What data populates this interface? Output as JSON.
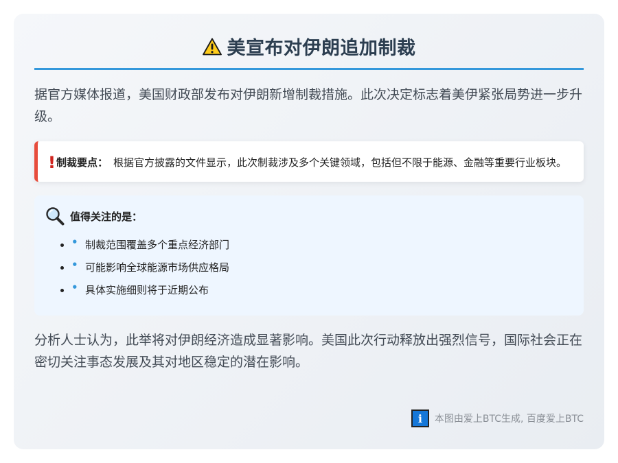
{
  "header": {
    "title": "美宣布对伊朗追加制裁",
    "icon": "warning-icon"
  },
  "lead_paragraph": "据官方媒体报道，美国财政部发布对伊朗新增制裁措施。此次决定标志着美伊紧张局势进一步升级。",
  "alert": {
    "icon": "exclamation-icon",
    "label": "制裁要点：",
    "text": "根据官方披露的文件显示，此次制裁涉及多个关键领域，包括但不限于能源、金融等重要行业板块。",
    "accent_color": "#e74c3c"
  },
  "notice": {
    "icon": "magnifier-icon",
    "heading": "值得关注的是：",
    "items": [
      "制裁范围覆盖多个重点经济部门",
      "可能影响全球能源市场供应格局",
      "具体实施细则将于近期公布"
    ],
    "bullet_color": "#3498db"
  },
  "closing_paragraph": "分析人士认为，此举将对伊朗经济造成显著影响。美国此次行动释放出强烈信号，国际社会正在密切关注事态发展及其对地区稳定的潜在影响。",
  "footer": {
    "icon": "info-icon",
    "icon_glyph": "i",
    "text": "本图由爱上BTC生成, 百度爱上BTC"
  },
  "colors": {
    "title_underline": "#3498db",
    "title_text": "#2c3e50",
    "notice_background": "#eef6ff"
  }
}
